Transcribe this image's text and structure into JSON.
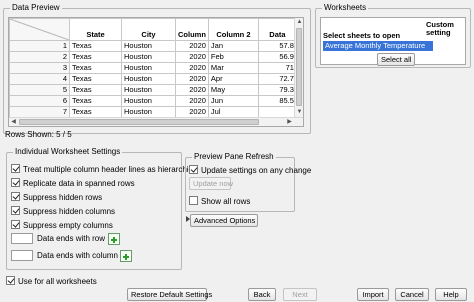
{
  "data_preview": {
    "title": "Data Preview",
    "columns": [
      "",
      "State",
      "City",
      "Column",
      "Column 2",
      "Data"
    ],
    "rows": [
      [
        "1",
        "Texas",
        "Houston",
        "2020",
        "Jan",
        "57.8"
      ],
      [
        "2",
        "Texas",
        "Houston",
        "2020",
        "Feb",
        "56.9"
      ],
      [
        "3",
        "Texas",
        "Houston",
        "2020",
        "Mar",
        "71"
      ],
      [
        "4",
        "Texas",
        "Houston",
        "2020",
        "Apr",
        "72.7"
      ],
      [
        "5",
        "Texas",
        "Houston",
        "2020",
        "May",
        "79.3"
      ],
      [
        "6",
        "Texas",
        "Houston",
        "2020",
        "Jun",
        "85.5"
      ],
      [
        "7",
        "Texas",
        "Houston",
        "2020",
        "Jul",
        ""
      ]
    ],
    "rows_shown": "Rows Shown: 5 / 5"
  },
  "worksheets": {
    "title": "Worksheets",
    "col_select": "Select sheets to open",
    "col_custom": "Custom setting",
    "items": [
      "Average Monthly Temperature"
    ],
    "select_all": "Select all"
  },
  "individual_settings": {
    "title": "Individual Worksheet Settings",
    "options": [
      {
        "label": "Treat multiple column header lines as hierarchies",
        "checked": true
      },
      {
        "label": "Replicate data in spanned rows",
        "checked": true
      },
      {
        "label": "Suppress hidden rows",
        "checked": true
      },
      {
        "label": "Suppress hidden columns",
        "checked": true
      },
      {
        "label": "Suppress empty columns",
        "checked": true
      }
    ],
    "data_ends_row": "Data ends with row",
    "data_ends_column": "Data ends with column"
  },
  "preview_refresh": {
    "title": "Preview Pane Refresh",
    "update_on_change": "Update settings on any change",
    "update_on_change_checked": true,
    "update_now": "Update now",
    "show_all_rows": "Show all rows",
    "show_all_rows_checked": false
  },
  "advanced_options": "Advanced Options",
  "use_for_all": {
    "label": "Use for all worksheets",
    "checked": true
  },
  "footer": {
    "restore": "Restore Default Settings",
    "back": "Back",
    "next": "Next",
    "import": "Import",
    "cancel": "Cancel",
    "help": "Help"
  },
  "colors": {
    "selection": "#3874d8",
    "plus_green": "#2e9a2e"
  }
}
